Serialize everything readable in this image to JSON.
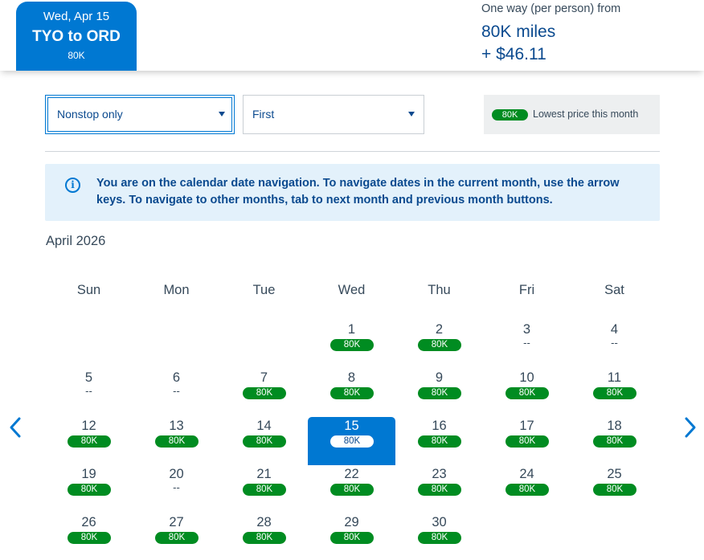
{
  "header": {
    "tab": {
      "date": "Wed, Apr 15",
      "route": "TYO to ORD",
      "price": "80K"
    },
    "fare": {
      "caption": "One way (per person) from",
      "miles": "80K miles",
      "tax": "+ $46.11"
    }
  },
  "filters": {
    "stops": {
      "value": "Nonstop only"
    },
    "cabin": {
      "value": "First"
    }
  },
  "legend": {
    "pill": "80K",
    "text": "Lowest price this month"
  },
  "info": {
    "icon": "info-icon",
    "text": "You are on the calendar date navigation. To navigate dates in the current month, use the arrow keys. To navigate to other months, tab to next month and previous month buttons."
  },
  "calendar": {
    "month": "April 2026",
    "weekdays": [
      "Sun",
      "Mon",
      "Tue",
      "Wed",
      "Thu",
      "Fri",
      "Sat"
    ],
    "selected_day": 15,
    "days": [
      {
        "num": "1",
        "price": "80K"
      },
      {
        "num": "2",
        "price": "80K"
      },
      {
        "num": "3",
        "price": "--"
      },
      {
        "num": "4",
        "price": "--"
      },
      {
        "num": "5",
        "price": "--"
      },
      {
        "num": "6",
        "price": "--"
      },
      {
        "num": "7",
        "price": "80K"
      },
      {
        "num": "8",
        "price": "80K"
      },
      {
        "num": "9",
        "price": "80K"
      },
      {
        "num": "10",
        "price": "80K"
      },
      {
        "num": "11",
        "price": "80K"
      },
      {
        "num": "12",
        "price": "80K"
      },
      {
        "num": "13",
        "price": "80K"
      },
      {
        "num": "14",
        "price": "80K"
      },
      {
        "num": "15",
        "price": "80K"
      },
      {
        "num": "16",
        "price": "80K"
      },
      {
        "num": "17",
        "price": "80K"
      },
      {
        "num": "18",
        "price": "80K"
      },
      {
        "num": "19",
        "price": "80K"
      },
      {
        "num": "20",
        "price": "--"
      },
      {
        "num": "21",
        "price": "80K"
      },
      {
        "num": "22",
        "price": "80K"
      },
      {
        "num": "23",
        "price": "80K"
      },
      {
        "num": "24",
        "price": "80K"
      },
      {
        "num": "25",
        "price": "80K"
      },
      {
        "num": "26",
        "price": "80K"
      },
      {
        "num": "27",
        "price": "80K"
      },
      {
        "num": "28",
        "price": "80K"
      },
      {
        "num": "29",
        "price": "80K"
      },
      {
        "num": "30",
        "price": "80K"
      }
    ]
  },
  "nav": {
    "prev_icon": "chevron-left-icon",
    "next_icon": "chevron-right-icon"
  },
  "colors": {
    "accent": "#0078d2",
    "price_green": "#008c21",
    "text_navy": "#0b4a8f",
    "info_bg": "#e3f1fb"
  }
}
